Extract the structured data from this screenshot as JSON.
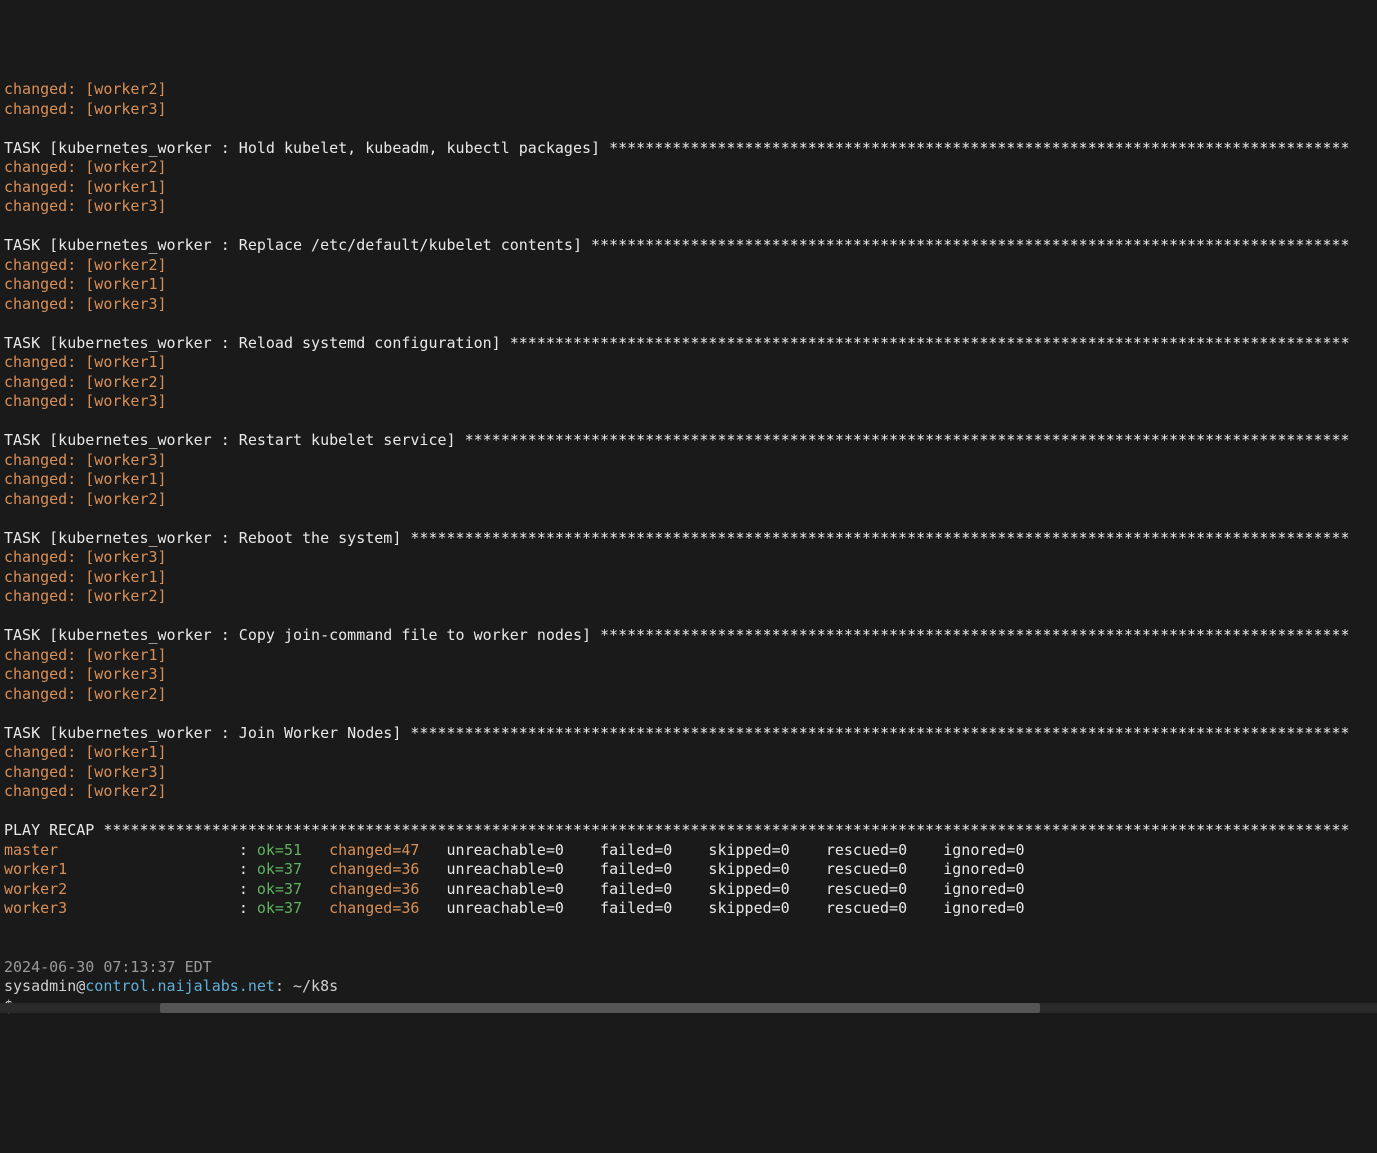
{
  "initial_changes": [
    "changed: [worker2]",
    "changed: [worker3]"
  ],
  "tasks": [
    {
      "title": "TASK [kubernetes_worker : Hold kubelet, kubeadm, kubectl packages] ",
      "changes": [
        "changed: [worker2]",
        "changed: [worker1]",
        "changed: [worker3]"
      ]
    },
    {
      "title": "TASK [kubernetes_worker : Replace /etc/default/kubelet contents] ",
      "changes": [
        "changed: [worker2]",
        "changed: [worker1]",
        "changed: [worker3]"
      ]
    },
    {
      "title": "TASK [kubernetes_worker : Reload systemd configuration] ",
      "changes": [
        "changed: [worker1]",
        "changed: [worker2]",
        "changed: [worker3]"
      ]
    },
    {
      "title": "TASK [kubernetes_worker : Restart kubelet service] ",
      "changes": [
        "changed: [worker3]",
        "changed: [worker1]",
        "changed: [worker2]"
      ]
    },
    {
      "title": "TASK [kubernetes_worker : Reboot the system] ",
      "changes": [
        "changed: [worker3]",
        "changed: [worker1]",
        "changed: [worker2]"
      ]
    },
    {
      "title": "TASK [kubernetes_worker : Copy join-command file to worker nodes] ",
      "changes": [
        "changed: [worker1]",
        "changed: [worker3]",
        "changed: [worker2]"
      ]
    },
    {
      "title": "TASK [kubernetes_worker : Join Worker Nodes] ",
      "changes": [
        "changed: [worker1]",
        "changed: [worker3]",
        "changed: [worker2]"
      ]
    }
  ],
  "recap_title": "PLAY RECAP ",
  "recap": [
    {
      "host": "master ",
      "ok": "ok=51",
      "changed": "changed=47",
      "rest": "   unreachable=0    failed=0    skipped=0    rescued=0    ignored=0"
    },
    {
      "host": "worker1",
      "ok": "ok=37",
      "changed": "changed=36",
      "rest": "   unreachable=0    failed=0    skipped=0    rescued=0    ignored=0"
    },
    {
      "host": "worker2",
      "ok": "ok=37",
      "changed": "changed=36",
      "rest": "   unreachable=0    failed=0    skipped=0    rescued=0    ignored=0"
    },
    {
      "host": "worker3",
      "ok": "ok=37",
      "changed": "changed=36",
      "rest": "   unreachable=0    failed=0    skipped=0    rescued=0    ignored=0"
    }
  ],
  "timestamp": "2024-06-30 07:13:37 EDT",
  "prompt": {
    "user": "sysadmin",
    "at": "@",
    "host": "control.naijalabs.net",
    "path": ": ~/k8s",
    "symbol": "$ "
  }
}
